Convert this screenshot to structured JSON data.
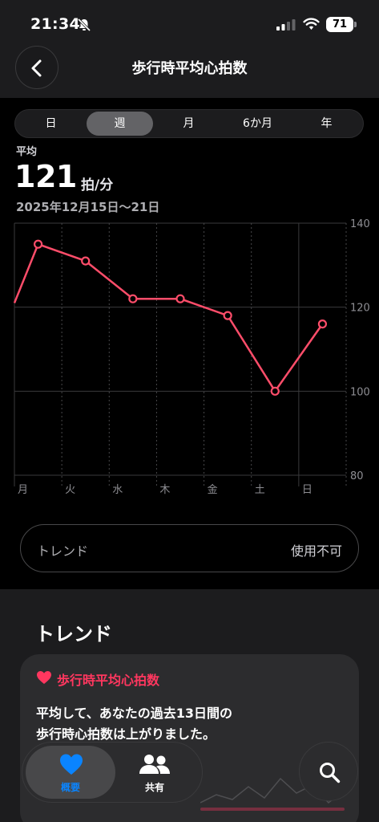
{
  "status_bar": {
    "time": "21:34",
    "battery": "71"
  },
  "header": {
    "title": "歩行時平均心拍数"
  },
  "segments": [
    {
      "label": "日",
      "active": false
    },
    {
      "label": "週",
      "active": true
    },
    {
      "label": "月",
      "active": false
    },
    {
      "label": "6か月",
      "active": false
    },
    {
      "label": "年",
      "active": false
    }
  ],
  "summary": {
    "label": "平均",
    "value": "121",
    "unit": "拍/分",
    "date_range": "2025年12月15日～21日"
  },
  "chart_data": {
    "type": "line",
    "categories": [
      "月",
      "火",
      "水",
      "木",
      "金",
      "土",
      "日"
    ],
    "series": [
      {
        "values": [
          135,
          131,
          122,
          122,
          118,
          100,
          116
        ],
        "color": "#ff4d6a"
      }
    ],
    "start_value": 121,
    "y_ticks": [
      "140",
      "120",
      "100",
      "80"
    ],
    "ylim": [
      80,
      140
    ],
    "grid": true
  },
  "trend_row": {
    "label": "トレンド",
    "value": "使用不可"
  },
  "trends": {
    "section_title": "トレンド",
    "card_title": "歩行時平均心拍数",
    "card_text_line1": "平均して、あなたの過去13日間の",
    "card_text_line2": "歩行時心拍数は上がりました。"
  },
  "tabbar": {
    "summary_label": "概要",
    "share_label": "共有"
  },
  "colors": {
    "accent_red": "#ff375f",
    "accent_blue": "#0a84ff"
  }
}
